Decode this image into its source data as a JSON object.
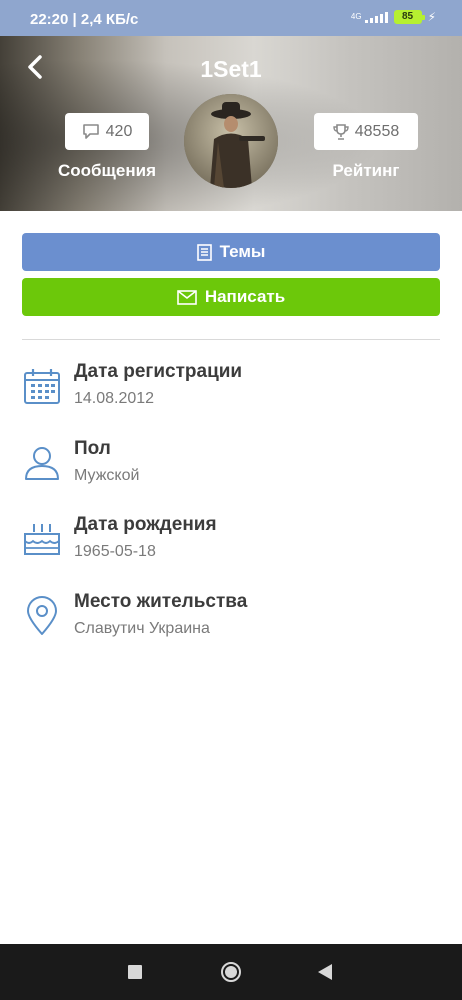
{
  "status_bar": {
    "time": "22:20 | 2,4 КБ/с",
    "network": "4G",
    "battery": "85"
  },
  "header": {
    "title": "1Set1",
    "messages_count": "420",
    "messages_label": "Сообщения",
    "rating_count": "48558",
    "rating_label": "Рейтинг"
  },
  "buttons": {
    "topics_label": "Темы",
    "write_label": "Написать",
    "topics_color": "#6b8fcf",
    "write_color": "#6cc80a"
  },
  "info": [
    {
      "label": "Дата регистрации",
      "value": "14.08.2012",
      "icon": "calendar-icon"
    },
    {
      "label": "Пол",
      "value": "Мужской",
      "icon": "person-icon"
    },
    {
      "label": "Дата рождения",
      "value": "1965-05-18",
      "icon": "birthday-cake-icon"
    },
    {
      "label": "Место жительства",
      "value": "Славутич Украина",
      "icon": "location-pin-icon"
    }
  ],
  "accent_icon_color": "#5a8fc8"
}
